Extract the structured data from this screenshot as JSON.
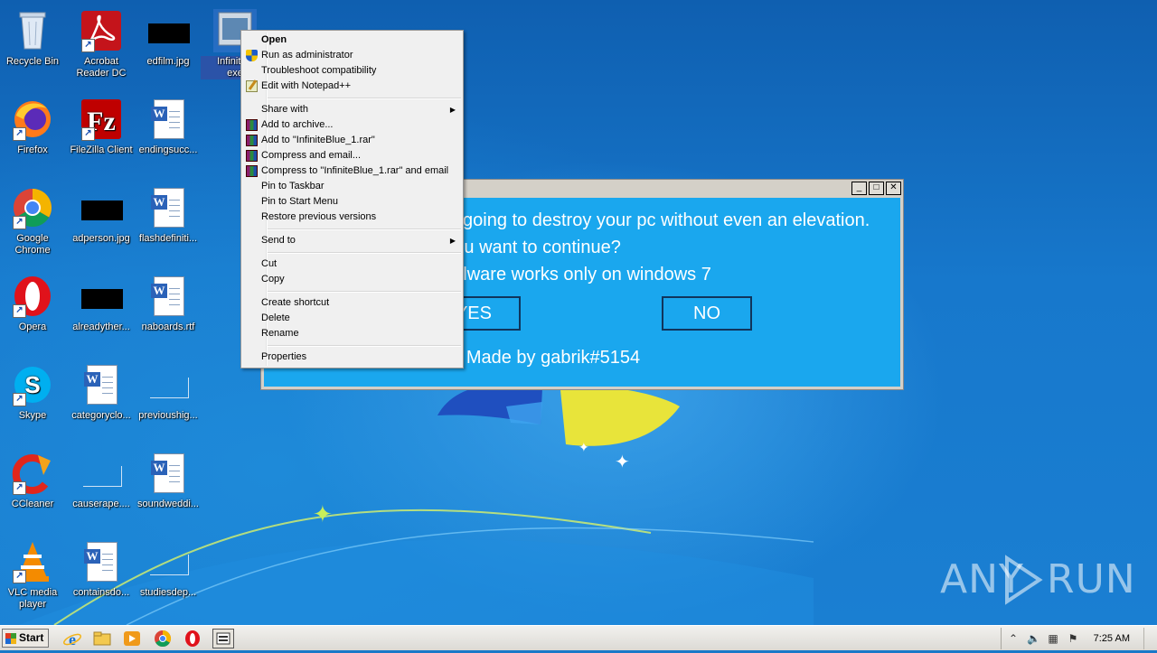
{
  "desktop": {
    "icons": [
      {
        "label": "Recycle Bin",
        "icon": "recycle-bin-icon"
      },
      {
        "label": "Acrobat Reader DC",
        "icon": "acrobat-icon"
      },
      {
        "label": "edfilm.jpg",
        "icon": "image-file-icon"
      },
      {
        "label": "InfiniteBlue_1.exe",
        "label_visible_top": "InfiniteB",
        "label_visible_bottom": "exe",
        "icon": "exe-file-icon"
      },
      {
        "label": "Firefox",
        "icon": "firefox-icon"
      },
      {
        "label": "FileZilla Client",
        "icon": "filezilla-icon"
      },
      {
        "label": "endingsucc...",
        "icon": "word-doc-icon"
      },
      {
        "label": "Google Chrome",
        "icon": "chrome-icon"
      },
      {
        "label": "adperson.jpg",
        "icon": "image-file-icon"
      },
      {
        "label": "flashdefiniti...",
        "icon": "word-doc-icon"
      },
      {
        "label": "Opera",
        "icon": "opera-icon"
      },
      {
        "label": "alreadyther...",
        "icon": "image-file-icon"
      },
      {
        "label": "naboards.rtf",
        "icon": "word-doc-icon"
      },
      {
        "label": "Skype",
        "icon": "skype-icon"
      },
      {
        "label": "categoryclo...",
        "icon": "word-doc-icon"
      },
      {
        "label": "previoushig...",
        "icon": "blank-file-icon"
      },
      {
        "label": "CCleaner",
        "icon": "ccleaner-icon"
      },
      {
        "label": "causerape....",
        "icon": "blank-file-icon"
      },
      {
        "label": "soundweddi...",
        "icon": "word-doc-icon"
      },
      {
        "label": "VLC media player",
        "icon": "vlc-icon"
      },
      {
        "label": "containsdo...",
        "icon": "word-doc-icon"
      },
      {
        "label": "studiesdep...",
        "icon": "blank-file-icon"
      }
    ]
  },
  "malware_window": {
    "line1": "going to destroy your pc without even an elevation.",
    "line2": "Do you want to continue?",
    "line3": "This malware works only on windows 7",
    "yes_label": "YES",
    "no_label": "NO",
    "credit": "Made by gabrik#5154",
    "controls": {
      "minimize": "_",
      "maximize": "□",
      "close": "✕"
    }
  },
  "context_menu": {
    "items": [
      {
        "label": "Open",
        "bold": true
      },
      {
        "label": "Run as administrator",
        "icon": "uac-shield-icon"
      },
      {
        "label": "Troubleshoot compatibility"
      },
      {
        "label": "Edit with Notepad++",
        "icon": "notepadpp-icon"
      },
      {
        "label": "Share with",
        "submenu": true
      },
      {
        "label": "Add to archive...",
        "icon": "winrar-icon"
      },
      {
        "label": "Add to \"InfiniteBlue_1.rar\"",
        "icon": "winrar-icon"
      },
      {
        "label": "Compress and email...",
        "icon": "winrar-icon"
      },
      {
        "label": "Compress to \"InfiniteBlue_1.rar\" and email",
        "icon": "winrar-icon"
      },
      {
        "label": "Pin to Taskbar"
      },
      {
        "label": "Pin to Start Menu"
      },
      {
        "label": "Restore previous versions"
      },
      {
        "label": "Send to",
        "submenu": true
      },
      {
        "label": "Cut"
      },
      {
        "label": "Copy"
      },
      {
        "label": "Create shortcut"
      },
      {
        "label": "Delete"
      },
      {
        "label": "Rename"
      },
      {
        "label": "Properties"
      }
    ]
  },
  "taskbar": {
    "start_label": "Start",
    "pinned": [
      "ie-icon",
      "explorer-icon",
      "media-player-icon",
      "chrome-icon",
      "opera-icon",
      "infiniteblue-app-icon"
    ],
    "clock": "7:25 AM"
  },
  "watermark": {
    "left": "ANY",
    "right": "RUN"
  }
}
